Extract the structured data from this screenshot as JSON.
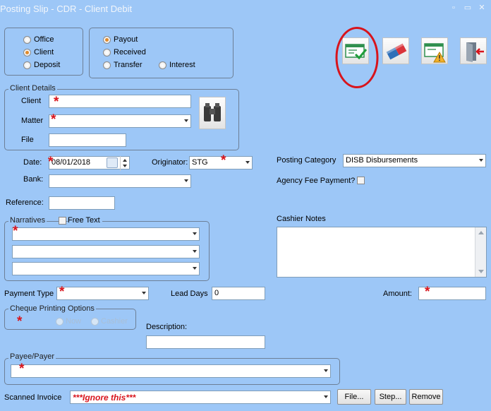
{
  "window": {
    "title": "Posting Slip - CDR - Client Debit",
    "min_glyph": "▫",
    "restore_glyph": "▭",
    "close_glyph": "✕"
  },
  "toolbar": {
    "post_icon": "post-check-icon",
    "clear_icon": "eraser-icon",
    "warning_icon": "cheque-warning-icon",
    "exit_icon": "exit-door-icon",
    "highlight_color": "#d8141c"
  },
  "type_options": {
    "office": "Office",
    "client": "Client",
    "deposit": "Deposit",
    "selected": "Client"
  },
  "method_options": {
    "payout": "Payout",
    "received": "Received",
    "transfer": "Transfer",
    "interest": "Interest",
    "selected": "Payout"
  },
  "client_details": {
    "legend": "Client Details",
    "client_label": "Client",
    "client_value": "",
    "matter_label": "Matter",
    "matter_value": "",
    "file_label": "File",
    "file_value": "",
    "search_icon": "binoculars-icon"
  },
  "form": {
    "date_label": "Date:",
    "date_value": "08/01/2018",
    "originator_label": "Originator:",
    "originator_value": "STG",
    "bank_label": "Bank:",
    "bank_value": "",
    "reference_label": "Reference:",
    "reference_value": "",
    "posting_category_label": "Posting Category",
    "posting_category_value": "DISB  Disbursements",
    "agency_fee_label": "Agency Fee Payment?",
    "narratives_legend": "Narratives",
    "free_text_label": "Free Text",
    "cashier_notes_label": "Cashier Notes",
    "payment_type_label": "Payment Type",
    "lead_days_label": "Lead Days",
    "lead_days_value": "0",
    "amount_label": "Amount:",
    "cheque_printing_legend": "Cheque Printing Options",
    "now_label": "Now",
    "cashier_label": "Cashier",
    "description_label": "Description:",
    "payee_payer_legend": "Payee/Payer",
    "scanned_invoice_label": "Scanned Invoice",
    "scanned_invoice_value": "***Ignore this***",
    "file_button": "File...",
    "step_button": "Step...",
    "remove_button": "Remove",
    "required_marker": "*"
  }
}
